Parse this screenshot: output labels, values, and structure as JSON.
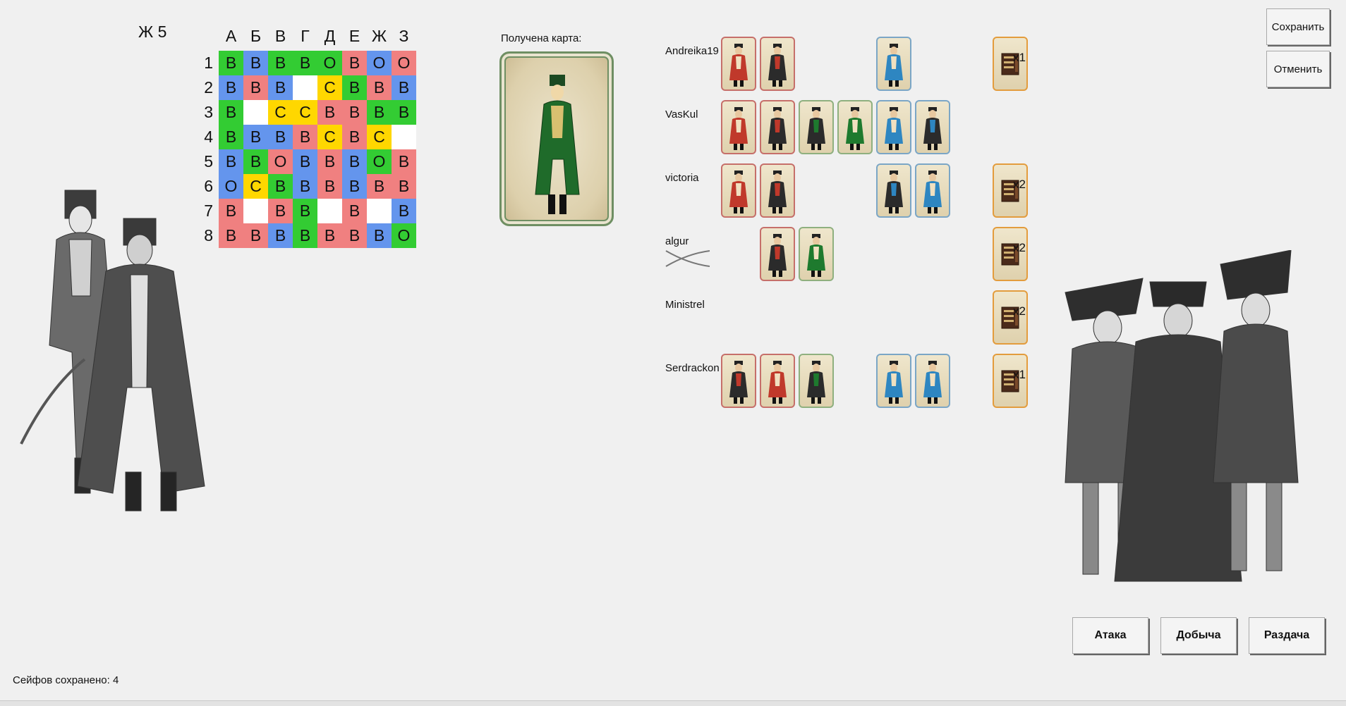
{
  "coordinate": "Ж 5",
  "grid": {
    "columns": [
      "А",
      "Б",
      "В",
      "Г",
      "Д",
      "Е",
      "Ж",
      "З"
    ],
    "rows": [
      "1",
      "2",
      "3",
      "4",
      "5",
      "6",
      "7",
      "8"
    ],
    "cells": [
      [
        {
          "t": "В",
          "c": "green"
        },
        {
          "t": "В",
          "c": "blue"
        },
        {
          "t": "В",
          "c": "green"
        },
        {
          "t": "В",
          "c": "green"
        },
        {
          "t": "О",
          "c": "green"
        },
        {
          "t": "В",
          "c": "red"
        },
        {
          "t": "О",
          "c": "blue"
        },
        {
          "t": "О",
          "c": "red"
        }
      ],
      [
        {
          "t": "В",
          "c": "blue"
        },
        {
          "t": "В",
          "c": "red"
        },
        {
          "t": "В",
          "c": "blue"
        },
        {
          "t": "",
          "c": "white"
        },
        {
          "t": "С",
          "c": "yellow"
        },
        {
          "t": "В",
          "c": "green"
        },
        {
          "t": "В",
          "c": "red"
        },
        {
          "t": "В",
          "c": "blue"
        }
      ],
      [
        {
          "t": "В",
          "c": "green"
        },
        {
          "t": "",
          "c": "white"
        },
        {
          "t": "С",
          "c": "yellow"
        },
        {
          "t": "С",
          "c": "yellow"
        },
        {
          "t": "В",
          "c": "red"
        },
        {
          "t": "В",
          "c": "red"
        },
        {
          "t": "В",
          "c": "green"
        },
        {
          "t": "В",
          "c": "green"
        }
      ],
      [
        {
          "t": "В",
          "c": "green"
        },
        {
          "t": "В",
          "c": "blue"
        },
        {
          "t": "В",
          "c": "blue"
        },
        {
          "t": "В",
          "c": "red"
        },
        {
          "t": "С",
          "c": "yellow"
        },
        {
          "t": "В",
          "c": "red"
        },
        {
          "t": "С",
          "c": "yellow"
        },
        {
          "t": "",
          "c": "white"
        }
      ],
      [
        {
          "t": "В",
          "c": "blue"
        },
        {
          "t": "В",
          "c": "green"
        },
        {
          "t": "О",
          "c": "red"
        },
        {
          "t": "В",
          "c": "blue"
        },
        {
          "t": "В",
          "c": "red"
        },
        {
          "t": "В",
          "c": "blue"
        },
        {
          "t": "О",
          "c": "green"
        },
        {
          "t": "В",
          "c": "red"
        }
      ],
      [
        {
          "t": "О",
          "c": "blue"
        },
        {
          "t": "С",
          "c": "yellow"
        },
        {
          "t": "В",
          "c": "green"
        },
        {
          "t": "В",
          "c": "blue"
        },
        {
          "t": "В",
          "c": "red"
        },
        {
          "t": "В",
          "c": "blue"
        },
        {
          "t": "В",
          "c": "red"
        },
        {
          "t": "В",
          "c": "red"
        }
      ],
      [
        {
          "t": "В",
          "c": "red"
        },
        {
          "t": "",
          "c": "white"
        },
        {
          "t": "В",
          "c": "red"
        },
        {
          "t": "В",
          "c": "green"
        },
        {
          "t": "",
          "c": "white"
        },
        {
          "t": "В",
          "c": "red"
        },
        {
          "t": "",
          "c": "white"
        },
        {
          "t": "В",
          "c": "blue"
        }
      ],
      [
        {
          "t": "В",
          "c": "red"
        },
        {
          "t": "В",
          "c": "red"
        },
        {
          "t": "В",
          "c": "blue"
        },
        {
          "t": "В",
          "c": "green"
        },
        {
          "t": "В",
          "c": "red"
        },
        {
          "t": "В",
          "c": "red"
        },
        {
          "t": "В",
          "c": "blue"
        },
        {
          "t": "О",
          "c": "green"
        }
      ]
    ]
  },
  "cell_colors": {
    "green": "#33cc33",
    "blue": "#6495ed",
    "red": "#f08080",
    "yellow": "#ffd700",
    "white": "#ffffff"
  },
  "card_border_colors": {
    "red": "#c66f6a",
    "green": "#8fb07f",
    "blue": "#7ba6c6",
    "orange": "#e39c3d"
  },
  "received_card": {
    "label": "Получена карта:",
    "icon": "hussar-woman-green-card"
  },
  "players": [
    {
      "name": "Andreika19",
      "cards": [
        {
          "slot": 0,
          "kind": "red-woman-card",
          "color": "red"
        },
        {
          "slot": 1,
          "kind": "red-man-card",
          "color": "red"
        },
        {
          "slot": 4,
          "kind": "blue-woman-card",
          "color": "blue"
        }
      ],
      "has_safe": true,
      "safe_count": "x1",
      "swords": false
    },
    {
      "name": "VasKul",
      "cards": [
        {
          "slot": 0,
          "kind": "red-woman-card",
          "color": "red"
        },
        {
          "slot": 1,
          "kind": "red-man-card",
          "color": "red"
        },
        {
          "slot": 2,
          "kind": "green-man-card",
          "color": "green"
        },
        {
          "slot": 3,
          "kind": "green-woman-card",
          "color": "green"
        },
        {
          "slot": 4,
          "kind": "blue-woman-card",
          "color": "blue"
        },
        {
          "slot": 5,
          "kind": "blue-man-card",
          "color": "blue"
        }
      ],
      "has_safe": false,
      "safe_count": "",
      "swords": false
    },
    {
      "name": "victoria",
      "cards": [
        {
          "slot": 0,
          "kind": "red-woman-card",
          "color": "red"
        },
        {
          "slot": 1,
          "kind": "red-man-card",
          "color": "red"
        },
        {
          "slot": 4,
          "kind": "blue-man-card",
          "color": "blue"
        },
        {
          "slot": 5,
          "kind": "blue-woman-card",
          "color": "blue"
        }
      ],
      "has_safe": true,
      "safe_count": "x2",
      "swords": false
    },
    {
      "name": "algur",
      "cards": [
        {
          "slot": 1,
          "kind": "red-man-card",
          "color": "red"
        },
        {
          "slot": 2,
          "kind": "green-woman-card",
          "color": "green"
        }
      ],
      "has_safe": true,
      "safe_count": "x2",
      "swords": true
    },
    {
      "name": "Ministrel",
      "cards": [],
      "has_safe": true,
      "safe_count": "x2",
      "swords": false
    },
    {
      "name": "Serdrackon",
      "cards": [
        {
          "slot": 0,
          "kind": "red-man-card",
          "color": "red"
        },
        {
          "slot": 1,
          "kind": "red-woman-card",
          "color": "red"
        },
        {
          "slot": 2,
          "kind": "green-man-card",
          "color": "green"
        },
        {
          "slot": 4,
          "kind": "blue-woman-card",
          "color": "blue"
        },
        {
          "slot": 5,
          "kind": "blue-woman-card",
          "color": "blue"
        }
      ],
      "has_safe": true,
      "safe_count": "x1",
      "swords": false
    }
  ],
  "buttons": {
    "save": "Сохранить",
    "cancel": "Отменить",
    "attack": "Атака",
    "loot": "Добыча",
    "deal": "Раздача"
  },
  "status": "Сейфов сохранено: 4"
}
